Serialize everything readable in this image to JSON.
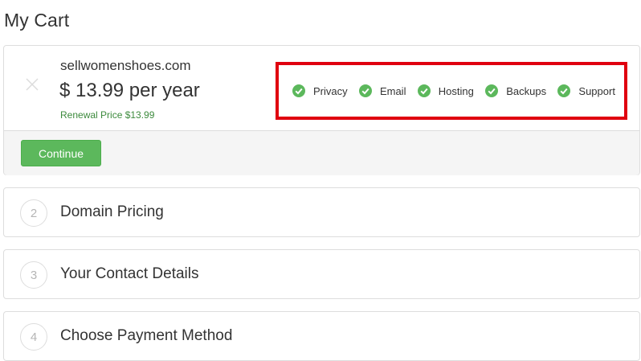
{
  "page": {
    "title": "My Cart"
  },
  "cart": {
    "domain": "sellwomenshoes.com",
    "price": "$ 13.99 per year",
    "renewal": "Renewal Price $13.99",
    "features": [
      {
        "label": "Privacy",
        "icon": "check-circle-icon"
      },
      {
        "label": "Email",
        "icon": "check-circle-icon"
      },
      {
        "label": "Hosting",
        "icon": "check-circle-icon"
      },
      {
        "label": "Backups",
        "icon": "check-circle-icon"
      },
      {
        "label": "Support",
        "icon": "check-circle-icon"
      }
    ],
    "continue_label": "Continue"
  },
  "steps": [
    {
      "number": "2",
      "title": "Domain Pricing"
    },
    {
      "number": "3",
      "title": "Your Contact Details"
    },
    {
      "number": "4",
      "title": "Choose Payment Method"
    }
  ],
  "colors": {
    "accent_green": "#5cb85c",
    "check_green": "#5cb85c",
    "highlight_red": "#e0000f",
    "renewal_green": "#3c8a3c"
  }
}
